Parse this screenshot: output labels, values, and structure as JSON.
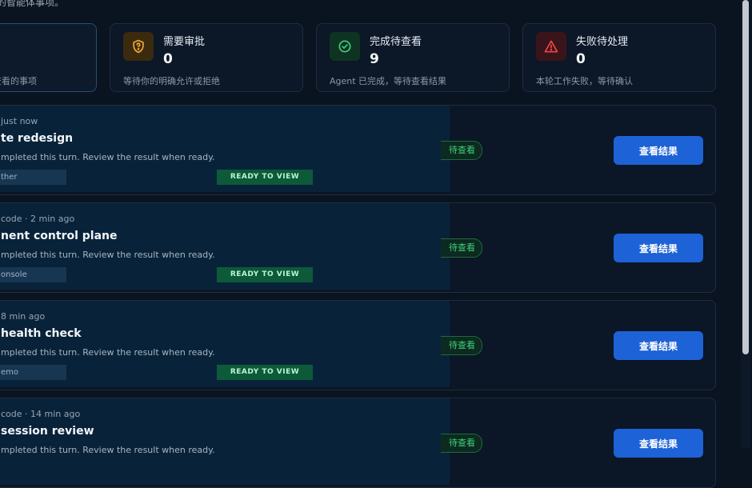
{
  "header": {
    "subtitle": "的智能体事项。"
  },
  "cards": [
    {
      "title": "",
      "value": "",
      "desc": "查看的事项"
    },
    {
      "title": "需要审批",
      "value": "0",
      "desc": "等待你的明确允许或拒绝",
      "icon": "shield-question-icon",
      "color": "#f4a93b"
    },
    {
      "title": "完成待查看",
      "value": "9",
      "desc": "Agent 已完成，等待查看结果",
      "icon": "check-circle-icon",
      "color": "#3fd07a"
    },
    {
      "title": "失败待处理",
      "value": "0",
      "desc": "本轮工作失败，等待确认",
      "icon": "warning-triangle-icon",
      "color": "#ef4444"
    }
  ],
  "rows": [
    {
      "meta": "just now",
      "title": "te redesign",
      "note": "mpleted this turn. Review the result when ready.",
      "tag": "ther",
      "ready": "READY TO VIEW",
      "status": "待查看",
      "button": "查看结果"
    },
    {
      "meta": "code · 2 min ago",
      "title": "nent control plane",
      "note": "mpleted this turn. Review the result when ready.",
      "tag": "onsole",
      "ready": "READY TO VIEW",
      "status": "待查看",
      "button": "查看结果"
    },
    {
      "meta": "8 min ago",
      "title": "health check",
      "note": "mpleted this turn. Review the result when ready.",
      "tag": "emo",
      "ready": "READY TO VIEW",
      "status": "待查看",
      "button": "查看结果"
    },
    {
      "meta": "code · 14 min ago",
      "title": "session review",
      "note": "mpleted this turn. Review the result when ready.",
      "tag": "",
      "ready": "",
      "status": "待查看",
      "button": "查看结果"
    }
  ]
}
